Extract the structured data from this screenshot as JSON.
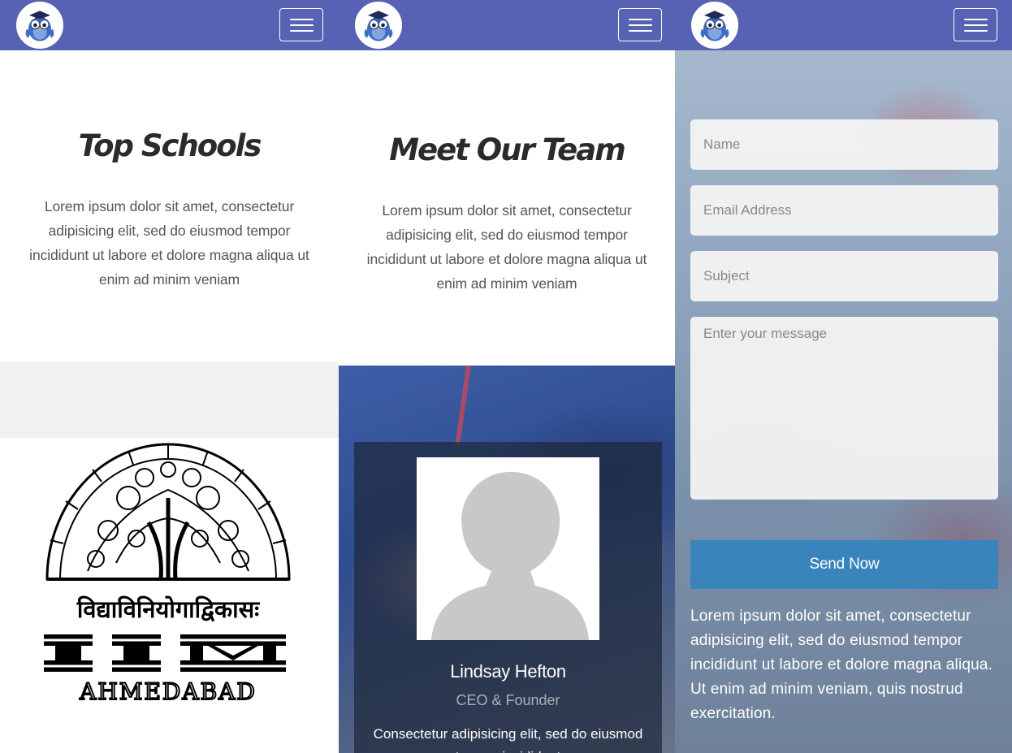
{
  "colors": {
    "navbar": "#5762b5",
    "button": "#3a84bc",
    "text": "#555555",
    "title": "#2b2b2b"
  },
  "navbar": {
    "logo_icon": "owl-graduate-icon",
    "menu_icon": "hamburger-menu-icon"
  },
  "schools": {
    "title": "Top Schools",
    "description": "Lorem ipsum dolor sit amet, consectetur adipisicing elit, sed do eiusmod tempor incididunt ut labore et dolore magna aliqua ut enim ad minim veniam",
    "logo": {
      "sanskrit_motto": "विद्याविनियोगाद्विकासः",
      "letters": "IIM",
      "city": "AHMEDABAD"
    }
  },
  "team": {
    "title": "Meet Our Team",
    "description": "Lorem ipsum dolor sit amet, consectetur adipisicing elit, sed do eiusmod tempor incididunt ut labore et dolore magna aliqua ut enim ad minim veniam",
    "member": {
      "name": "Lindsay Hefton",
      "role": "CEO & Founder",
      "bio": "Consectetur adipisicing elit, sed do eiusmod tempor incididunt"
    }
  },
  "contact": {
    "name_placeholder": "Name",
    "email_placeholder": "Email Address",
    "subject_placeholder": "Subject",
    "message_placeholder": "Enter your message",
    "send_label": "Send Now",
    "text": "Lorem ipsum dolor sit amet, consectetur adipisicing elit, sed do eiusmod tempor incididunt ut labore et dolore magna aliqua. Ut enim ad minim veniam, quis nostrud exercitation."
  }
}
